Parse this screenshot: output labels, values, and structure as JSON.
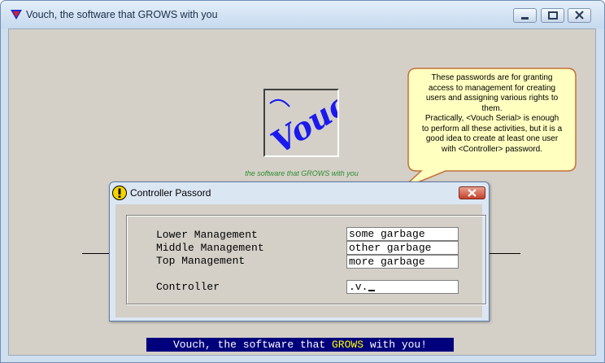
{
  "window": {
    "title": "Vouch, the software that GROWS with you",
    "app_icon": "red-blue-triangle-icon",
    "controls": [
      "minimize-icon",
      "maximize-icon",
      "close-icon"
    ]
  },
  "splash": {
    "logo_text": "Vouch",
    "tagline": "the software that GROWS with you"
  },
  "callout": {
    "lines": [
      "These passwords are for granting",
      "access to management for creating",
      "users and assigning various rights to",
      "them.",
      "Practically, <Vouch Serial> is enough",
      "to perform all these activities, but it is a",
      "good idea to create at least one user",
      "with <Controller> password."
    ]
  },
  "dialog": {
    "title": "Controller Passord",
    "icon": "warning-icon",
    "fields": [
      {
        "label": "Lower Management",
        "value": "some garbage"
      },
      {
        "label": "Middle Management",
        "value": "other garbage"
      },
      {
        "label": "Top Management",
        "value": "more garbage"
      },
      {
        "label": "Controller",
        "value": ".v."
      }
    ]
  },
  "status_bar": {
    "before": "Vouch, the software that ",
    "highlight": "GROWS",
    "after": " with you!"
  },
  "colors": {
    "status_bar_bg": "#00007c",
    "status_bar_highlight": "#ffff00",
    "tagline": "#2e8b2e",
    "logo": "#1a1aee",
    "callout_fill": "#ffffc0"
  }
}
